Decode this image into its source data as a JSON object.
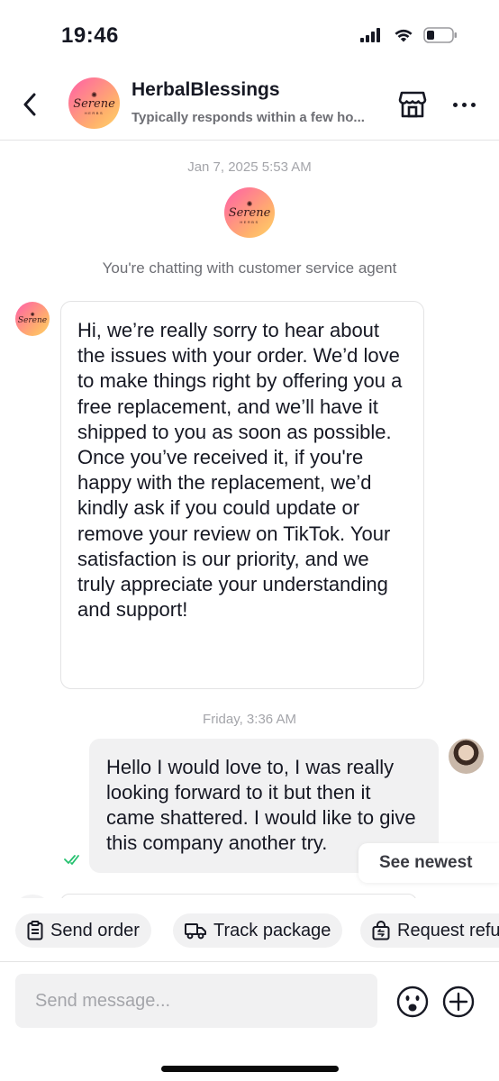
{
  "status_bar": {
    "time": "19:46",
    "signal_icon": "cellular-signal-icon",
    "wifi_icon": "wifi-icon",
    "battery_icon": "battery-low-icon"
  },
  "header": {
    "back_icon": "chevron-left-icon",
    "shop_name": "HerbalBlessings",
    "subtitle": "Typically responds within a few ho...",
    "logo_text": "Serene",
    "logo_subtext": "HERBS",
    "store_icon": "storefront-icon",
    "more_icon": "more-horizontal-icon"
  },
  "chat": {
    "timestamp_1": "Jan 7, 2025 5:53 AM",
    "system_note": "You're chatting with customer service agent",
    "agent_message": "Hi, we’re really sorry to hear about the issues with your order. We’d love to make things right by offering you a free replacement, and we’ll have it shipped to you as soon as possible. Once you’ve received it, if you're happy with the replacement, we’d kindly ask if you could update or remove your review on TikTok. Your satisfaction is our priority, and we truly appreciate your understanding and support!",
    "timestamp_2": "Friday, 3:36 AM",
    "user_message": "Hello I would love to, I was really looking forward to it but then it came shattered. I would like to give this company another try.",
    "read_receipt_icon": "double-check-icon",
    "see_newest": "See newest"
  },
  "quick_actions": [
    {
      "label": "Send order",
      "icon": "clipboard-icon"
    },
    {
      "label": "Track package",
      "icon": "truck-icon"
    },
    {
      "label": "Request refund",
      "icon": "refund-bag-icon"
    }
  ],
  "composer": {
    "placeholder": "Send message...",
    "emoji_icon": "emoji-icon",
    "plus_icon": "plus-circle-icon"
  },
  "colors": {
    "accent_gradient_start": "#ff5ea8",
    "accent_gradient_end": "#ffd46b",
    "read_receipt": "#25c16f"
  }
}
